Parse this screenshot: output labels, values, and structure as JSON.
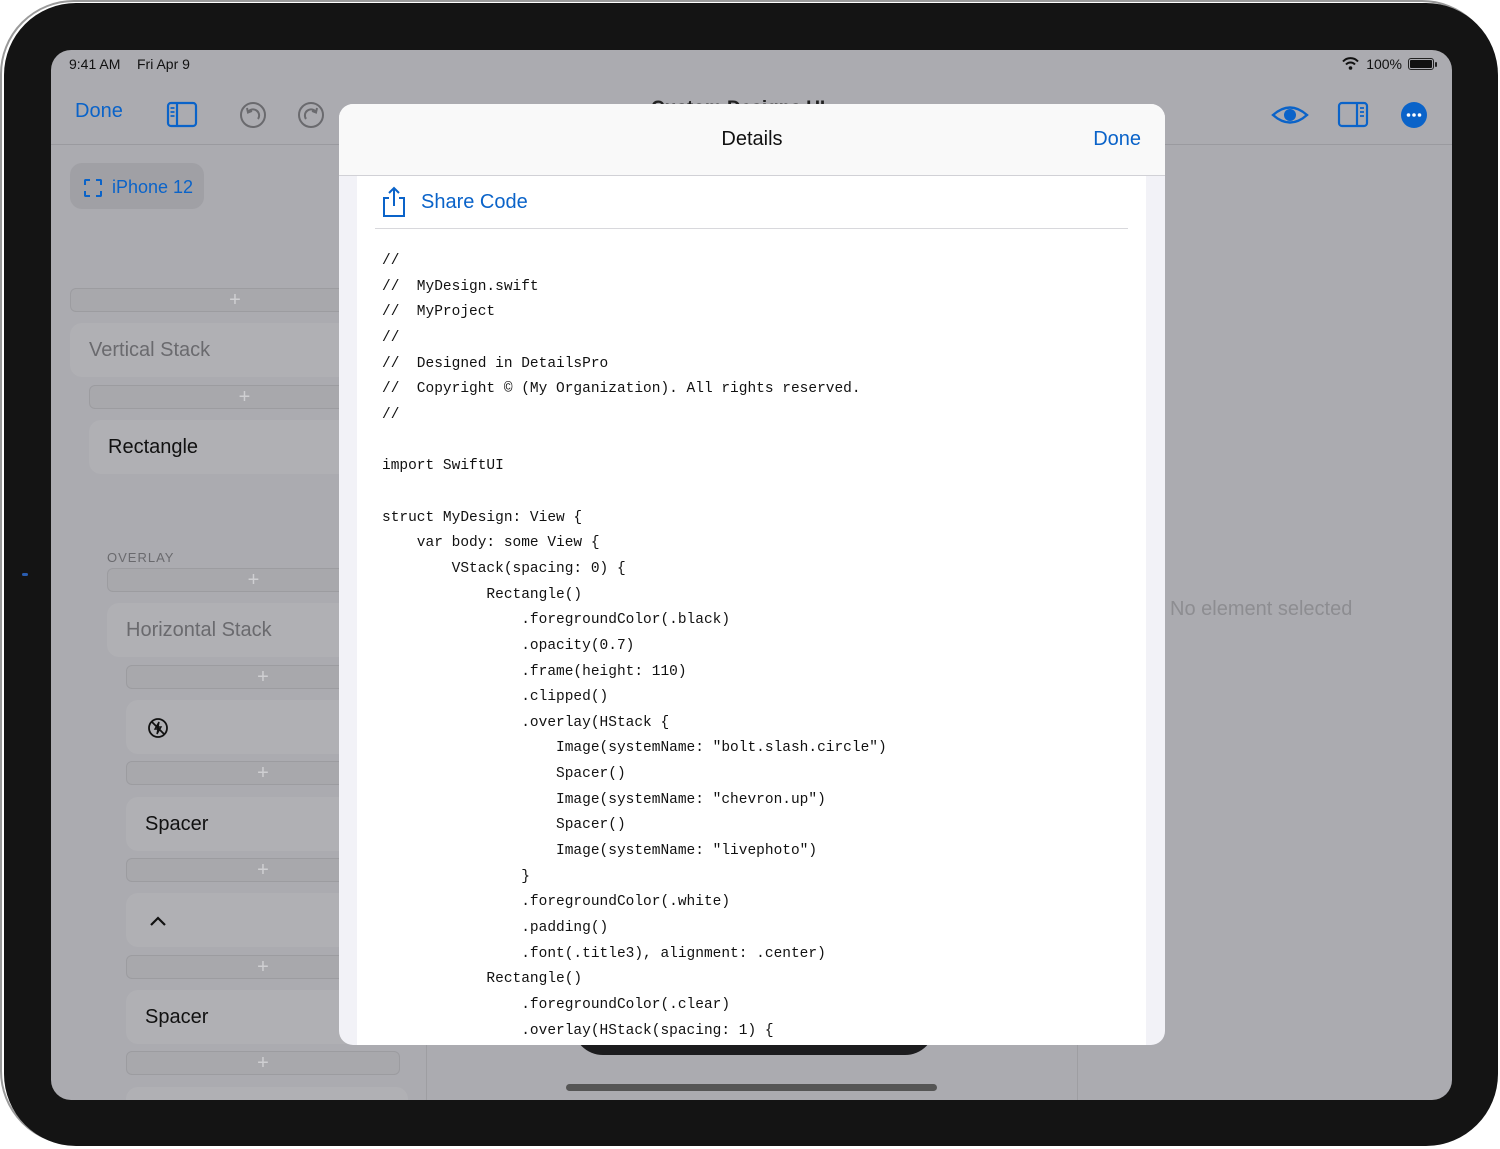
{
  "status_bar": {
    "time": "9:41 AM",
    "date": "Fri Apr 9",
    "battery": "100%",
    "battery_level": 1.0
  },
  "toolbar": {
    "done_label": "Done",
    "document_title": "Custom Designs UI"
  },
  "sidebar": {
    "device_chip": "iPhone 12",
    "vertical_stack": "Vertical Stack",
    "rectangle": "Rectangle",
    "overlay_header": "OVERLAY",
    "horizontal_stack": "Horizontal Stack",
    "spacer_1": "Spacer",
    "spacer_2": "Spacer",
    "icons": [
      "bolt-slash-circle-icon",
      "chevron-up-icon",
      "livephoto-icon"
    ]
  },
  "inspector": {
    "empty_text": "No element selected"
  },
  "modal": {
    "title": "Details",
    "done_label": "Done",
    "share_label": "Share Code",
    "code_lines": [
      "//",
      "//  MyDesign.swift",
      "//  MyProject",
      "//",
      "//  Designed in DetailsPro",
      "//  Copyright © (My Organization). All rights reserved.",
      "//",
      "",
      "import SwiftUI",
      "",
      "struct MyDesign: View {",
      "    var body: some View {",
      "        VStack(spacing: 0) {",
      "            Rectangle()",
      "                .foregroundColor(.black)",
      "                .opacity(0.7)",
      "                .frame(height: 110)",
      "                .clipped()",
      "                .overlay(HStack {",
      "                    Image(systemName: \"bolt.slash.circle\")",
      "                    Spacer()",
      "                    Image(systemName: \"chevron.up\")",
      "                    Spacer()",
      "                    Image(systemName: \"livephoto\")",
      "                }",
      "                .foregroundColor(.white)",
      "                .padding()",
      "                .font(.title3), alignment: .center)",
      "            Rectangle()",
      "                .foregroundColor(.clear)",
      "                .overlay(HStack(spacing: 1) {"
    ]
  },
  "colors": {
    "accent": "#0A63C9",
    "dimmed_background": "#ABABB0",
    "sheet": "#FFFFFF"
  }
}
